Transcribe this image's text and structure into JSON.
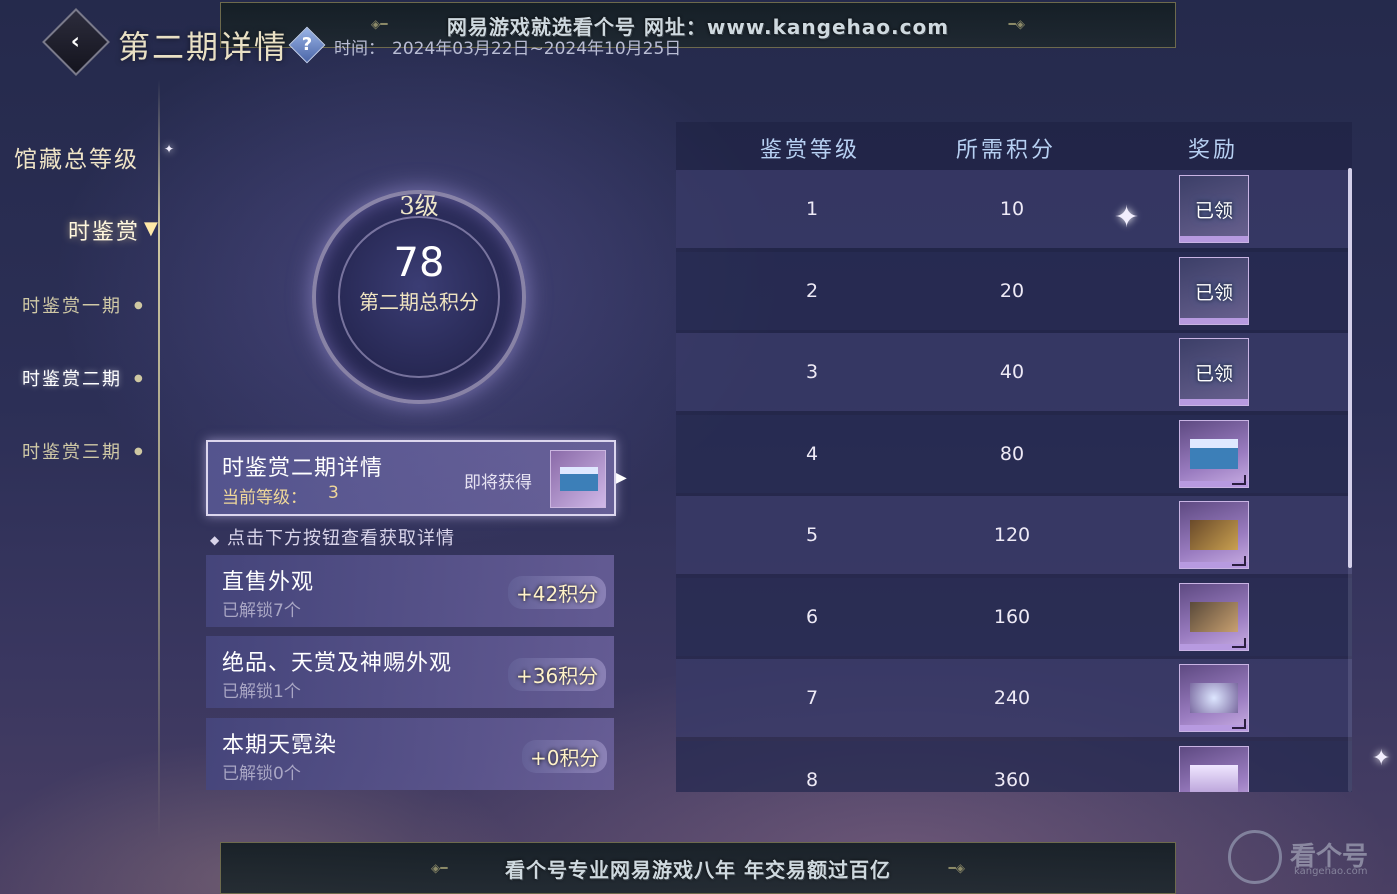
{
  "top_banner": {
    "text": "网易游戏就选看个号  网址：www.kangehao.com"
  },
  "bottom_banner": {
    "text": "看个号专业网易游戏八年  年交易额过百亿"
  },
  "header": {
    "title": "第二期详情",
    "time_label": "时间：",
    "time_value": "2024年03月22日~2024年10月25日"
  },
  "sidebar": {
    "group_title": "馆藏总等级",
    "active_section": "时鉴赏",
    "items": [
      {
        "label": "时鉴赏一期",
        "active": false
      },
      {
        "label": "时鉴赏二期",
        "active": true
      },
      {
        "label": "时鉴赏三期",
        "active": false
      }
    ]
  },
  "score": {
    "level": "3级",
    "total": "78",
    "caption": "第二期总积分"
  },
  "detail": {
    "title": "时鉴赏二期详情",
    "level_label": "当前等级：",
    "level_value": "3",
    "upcoming_label": "即将获得"
  },
  "hint": "点击下方按钮查看获取详情",
  "categories": [
    {
      "title": "直售外观",
      "unlocked": "已解锁7个",
      "points": "+42积分"
    },
    {
      "title": "绝品、天赏及神赐外观",
      "unlocked": "已解锁1个",
      "points": "+36积分"
    },
    {
      "title": "本期天霓染",
      "unlocked": "已解锁0个",
      "points": "+0积分"
    }
  ],
  "table": {
    "headers": [
      "鉴赏等级",
      "所需积分",
      "奖励"
    ],
    "rows": [
      {
        "level": "1",
        "points": "10",
        "claimed": true,
        "claimed_text": "已领"
      },
      {
        "level": "2",
        "points": "20",
        "claimed": true,
        "claimed_text": "已领"
      },
      {
        "level": "3",
        "points": "40",
        "claimed": true,
        "claimed_text": "已领"
      },
      {
        "level": "4",
        "points": "80",
        "claimed": false,
        "claimed_text": ""
      },
      {
        "level": "5",
        "points": "120",
        "claimed": false,
        "claimed_text": ""
      },
      {
        "level": "6",
        "points": "160",
        "claimed": false,
        "claimed_text": ""
      },
      {
        "level": "7",
        "points": "240",
        "claimed": false,
        "claimed_text": ""
      },
      {
        "level": "8",
        "points": "360",
        "claimed": false,
        "claimed_text": ""
      }
    ]
  },
  "watermark": {
    "name": "看个号",
    "url": "kangehao.com"
  },
  "colors": {
    "accent_gold": "#f0d89a",
    "header_blue": "#b7d0f2",
    "panel": "#2c2f56"
  }
}
